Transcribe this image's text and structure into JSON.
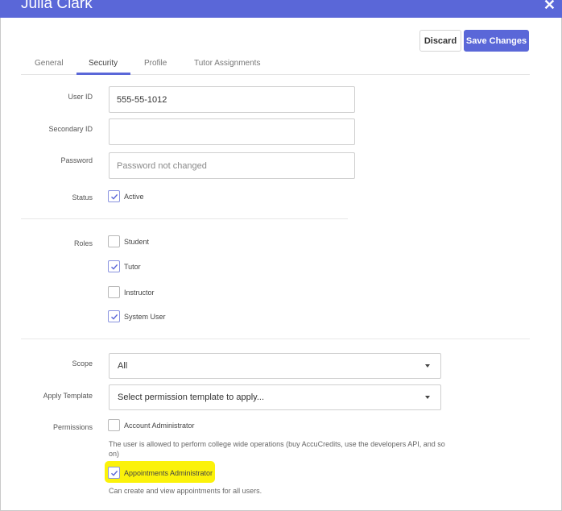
{
  "dialog": {
    "title": "Julia Clark",
    "close_glyph": "✕"
  },
  "toolbar": {
    "discard_label": "Discard",
    "save_label": "Save Changes"
  },
  "tabs": [
    {
      "label": "General"
    },
    {
      "label": "Security",
      "active": true
    },
    {
      "label": "Profile"
    },
    {
      "label": "Tutor Assignments"
    }
  ],
  "fields": {
    "user_id": {
      "label": "User ID",
      "value": "555-55-1012"
    },
    "secondary_id": {
      "label": "Secondary ID",
      "value": ""
    },
    "password": {
      "label": "Password",
      "placeholder": "Password not changed"
    },
    "status": {
      "label": "Status",
      "option": "Active",
      "checked": true
    }
  },
  "roles": {
    "label": "Roles",
    "items": [
      {
        "label": "Student",
        "checked": false
      },
      {
        "label": "Tutor",
        "checked": true
      },
      {
        "label": "Instructor",
        "checked": false
      },
      {
        "label": "System User",
        "checked": true
      }
    ]
  },
  "scope": {
    "label": "Scope",
    "value": "All"
  },
  "apply_template": {
    "label": "Apply Template",
    "value": "Select permission template to apply..."
  },
  "permissions": {
    "label": "Permissions",
    "items": [
      {
        "label": "Account Administrator",
        "checked": false,
        "description": "The user is allowed to perform college wide operations (buy AccuCredits, use the developers API, and so on)"
      },
      {
        "label": "Appointments Administrator",
        "checked": true,
        "highlighted": true,
        "description": "Can create and view appointments for all users."
      }
    ]
  },
  "colors": {
    "accent": "#5a67d8",
    "highlight": "#fbf20a"
  }
}
